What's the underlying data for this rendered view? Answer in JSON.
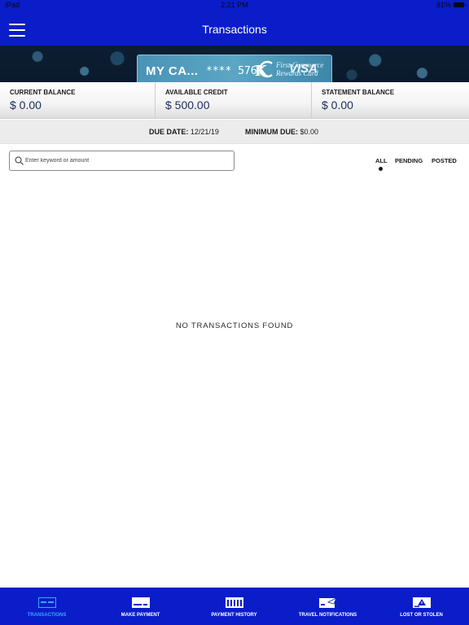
{
  "status_bar": {
    "carrier": "iPad",
    "time": "2:21 PM",
    "battery_text": "81%"
  },
  "header": {
    "title": "Transactions",
    "menu_icon": "hamburger-menu-icon"
  },
  "card": {
    "name": "MY CA...",
    "number_masked": "**** 5767",
    "brand_text_line1": "First Commerce",
    "brand_text_line2": "Rewards Card",
    "network": "VISA",
    "logo_icon": "kc-logo-icon"
  },
  "balances": [
    {
      "label": "CURRENT BALANCE",
      "value": "$ 0.00"
    },
    {
      "label": "AVAILABLE CREDIT",
      "value": "$ 500.00"
    },
    {
      "label": "STATEMENT BALANCE",
      "value": "$ 0.00"
    }
  ],
  "due": {
    "due_date_label": "DUE DATE:",
    "due_date_value": "12/21/19",
    "minimum_due_label": "MINIMUM DUE:",
    "minimum_due_value": "$0.00"
  },
  "search": {
    "placeholder": "Enter keyword or amount",
    "value": "",
    "icon": "search-icon"
  },
  "filters": {
    "selected": "ALL",
    "items": [
      "ALL",
      "PENDING",
      "POSTED"
    ]
  },
  "empty_message": "NO TRANSACTIONS FOUND",
  "tabbar": {
    "active": "TRANSACTIONS",
    "tabs": [
      {
        "label": "TRANSACTIONS",
        "icon": "transactions-icon"
      },
      {
        "label": "MAKE PAYMENT",
        "icon": "make-payment-icon"
      },
      {
        "label": "PAYMENT HISTORY",
        "icon": "payment-history-icon"
      },
      {
        "label": "TRAVEL NOTIFICATIONS",
        "icon": "travel-notifications-icon"
      },
      {
        "label": "LOST OR STOLEN",
        "icon": "lost-or-stolen-icon"
      }
    ]
  },
  "colors": {
    "primary": "#0a1dc9",
    "active_tab": "#36a8ff",
    "value_text": "#1b2b5c"
  }
}
